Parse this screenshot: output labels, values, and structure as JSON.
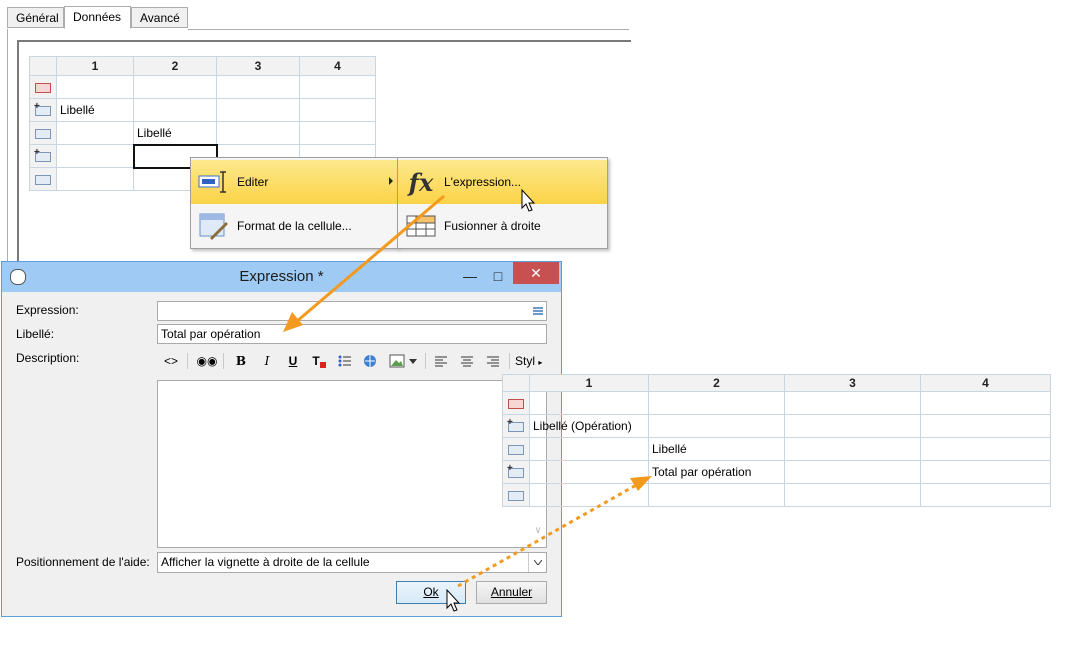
{
  "tabs": [
    "Général",
    "Données",
    "Avancé"
  ],
  "background_grid": {
    "columns": [
      "1",
      "2",
      "3",
      "4"
    ],
    "row2_col1": "Libellé (Opération)",
    "row2_col1_visible": "Libellé",
    "row3_col2": "Libellé"
  },
  "context_menu": {
    "items": [
      "Editer",
      "Format de la cellule..."
    ],
    "submenu_items": [
      "L'expression...",
      "Fusionner à droite"
    ],
    "submenu_icon_text": "fx"
  },
  "dialog": {
    "title": "Expression *",
    "expression_label": "Expression:",
    "expression_value": "",
    "libelle_label": "Libellé:",
    "libelle_value": "Total par opération",
    "description_label": "Description:",
    "toolbar": {
      "bold": "B",
      "italic": "I",
      "underline": "U",
      "style": "Styl"
    },
    "position_label": "Positionnement de l'aide:",
    "position_value": "Afficher la vignette à droite de la cellule",
    "ok_label": "Ok",
    "cancel_label": "Annuler"
  },
  "result_grid": {
    "columns": [
      "1",
      "2",
      "3",
      "4"
    ],
    "row2_col1": "Libellé (Opération)",
    "row3_col2": "Libellé",
    "row4_col2": "Total par opération"
  },
  "colors": {
    "arrow": "#f39a1e",
    "menu_highlight": "#fbd347",
    "title_bar": "#9ecaf3",
    "close_button": "#c75050"
  }
}
